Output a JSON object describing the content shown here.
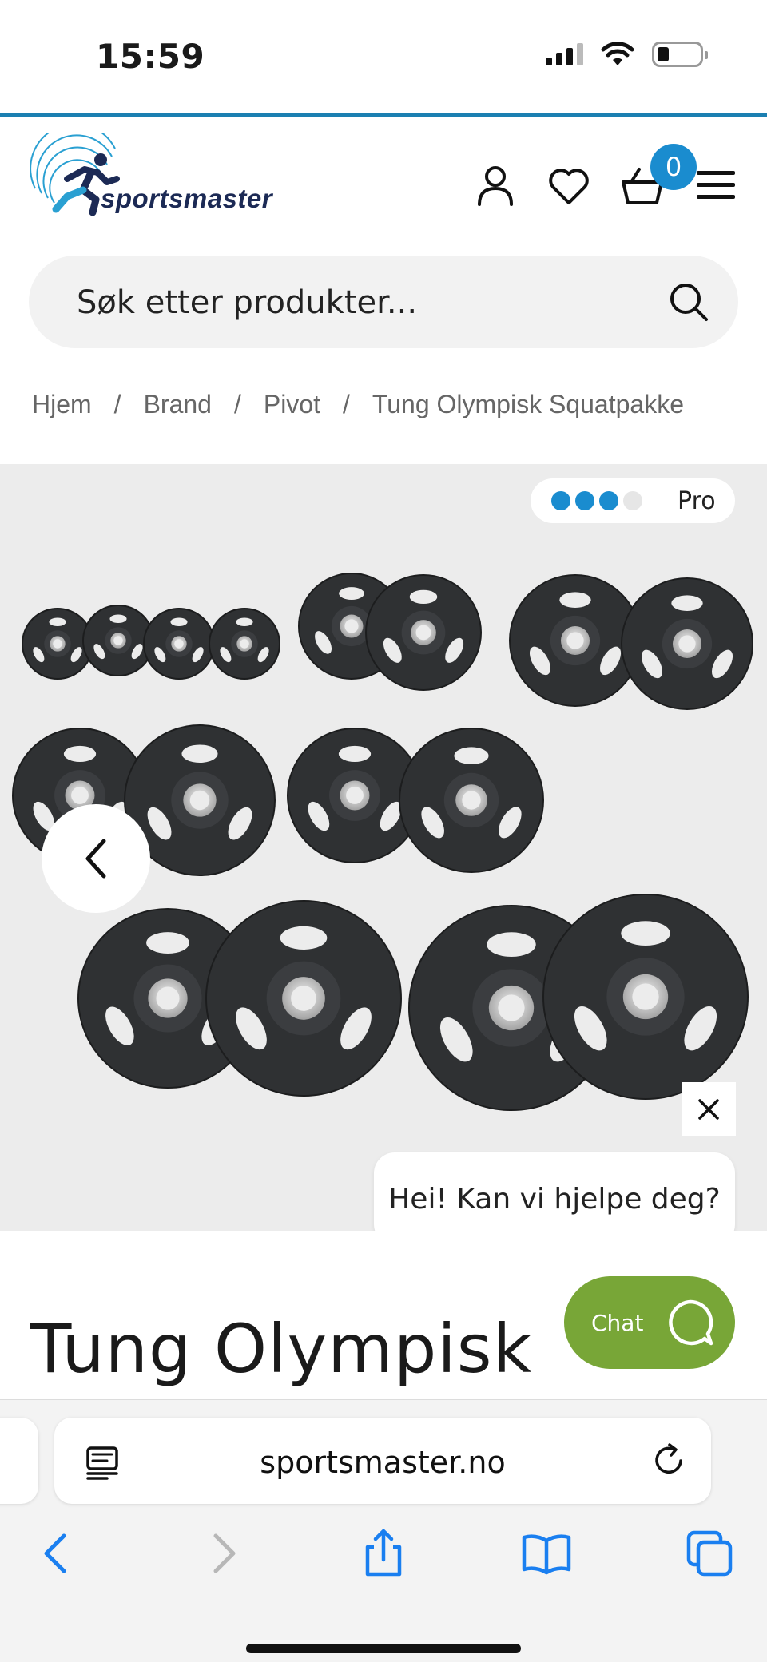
{
  "status_bar": {
    "time": "15:59"
  },
  "header": {
    "logo_text": "sportsmaster",
    "cart_count": "0",
    "icons": [
      "account-icon",
      "heart-icon",
      "basket-icon",
      "menu-icon"
    ],
    "accent_color": "#1a8ccf"
  },
  "search": {
    "placeholder": "Søk etter produkter..."
  },
  "breadcrumb": {
    "items": [
      "Hjem",
      "Brand",
      "Pivot",
      "Tung Olympisk Squatpakke"
    ],
    "separator": "/"
  },
  "gallery": {
    "badge_label": "Pro",
    "badge_level": 3,
    "badge_max": 4
  },
  "chat": {
    "bubble_text": "Hei! Kan vi hjelpe deg?",
    "button_label": "Chat",
    "button_color": "#78a637"
  },
  "product": {
    "title": "Tung Olympisk"
  },
  "browser": {
    "url": "sportsmaster.no"
  }
}
